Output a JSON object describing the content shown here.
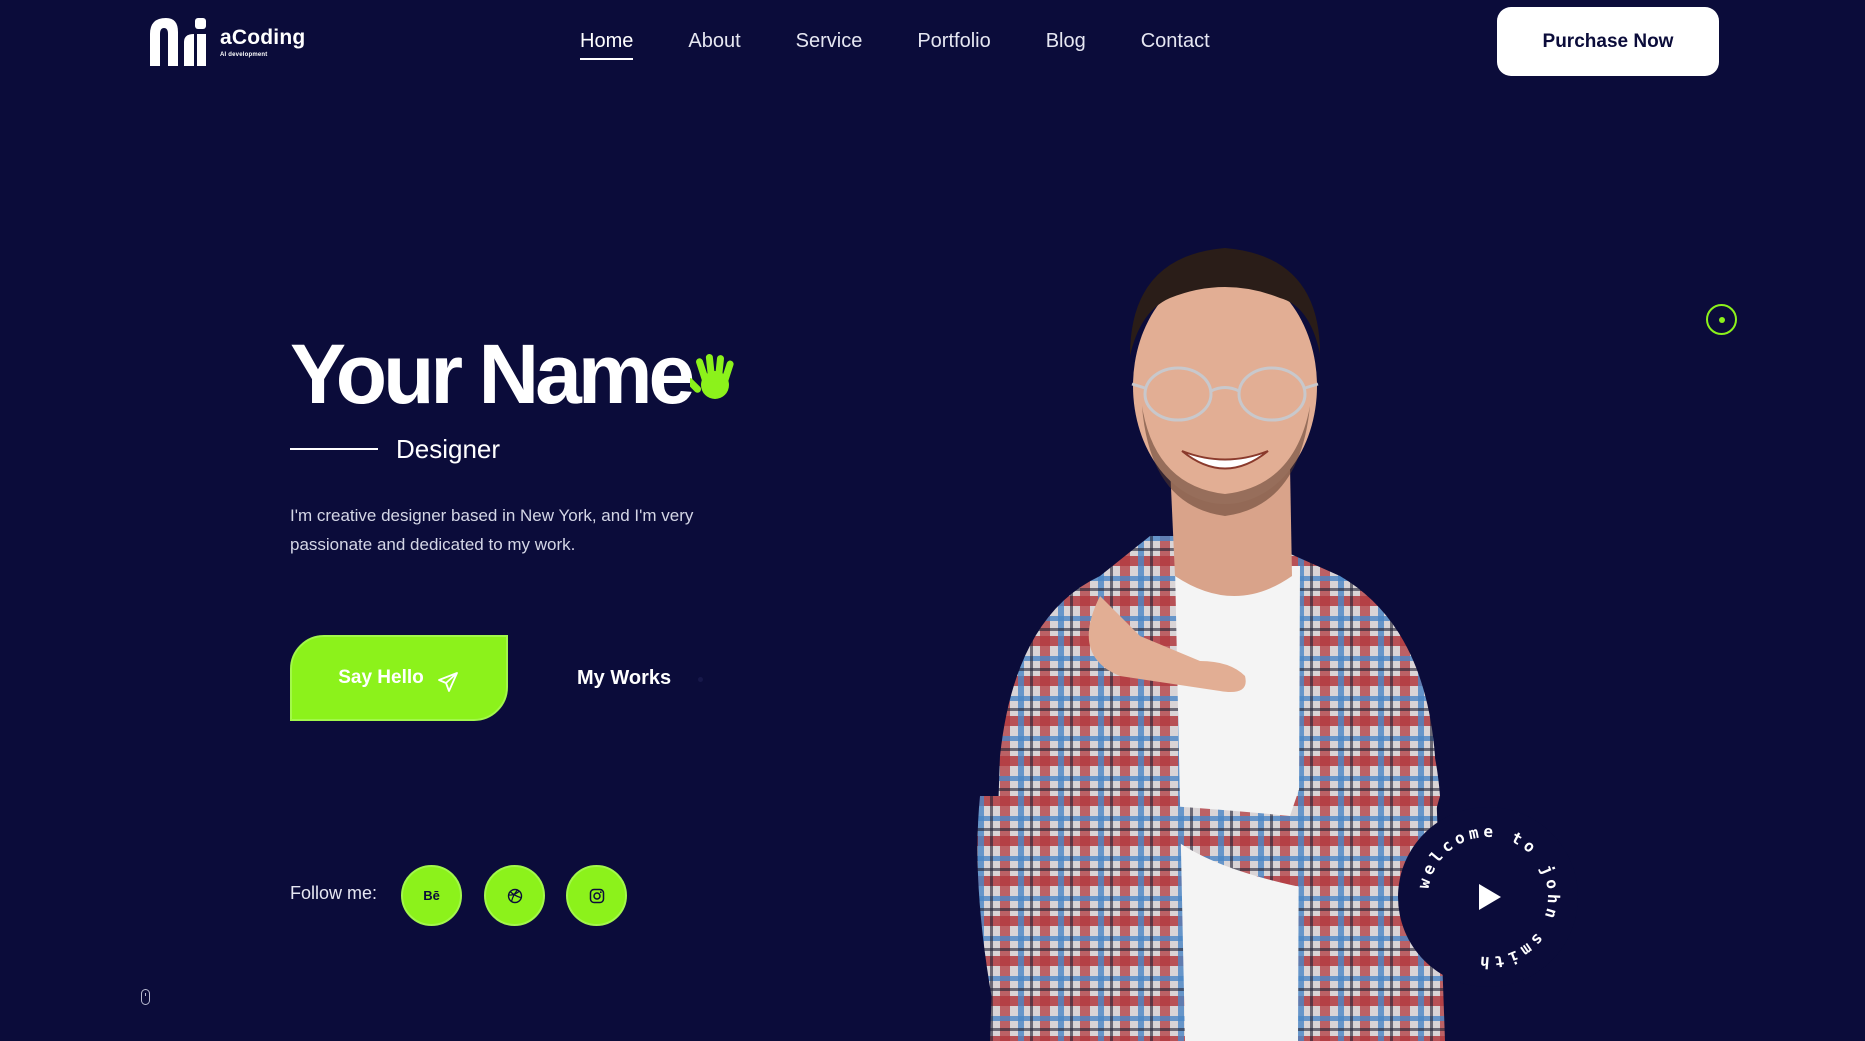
{
  "brand": {
    "name": "aCoding",
    "tagline": "AI development"
  },
  "nav": {
    "items": [
      {
        "label": "Home",
        "active": true
      },
      {
        "label": "About",
        "active": false
      },
      {
        "label": "Service",
        "active": false
      },
      {
        "label": "Portfolio",
        "active": false
      },
      {
        "label": "Blog",
        "active": false
      },
      {
        "label": "Contact",
        "active": false
      }
    ]
  },
  "header": {
    "purchase_label": "Purchase Now"
  },
  "hero": {
    "name": "Your Name",
    "role": "Designer",
    "description": "I'm creative designer based in New York, and I'm very passionate and dedicated to my work.",
    "say_hello_label": "Say Hello",
    "my_works_label": "My Works",
    "follow_label": "Follow me:"
  },
  "social": [
    {
      "label": "Bē",
      "icon": "behance-icon"
    },
    {
      "label": "",
      "icon": "dribbble-icon"
    },
    {
      "label": "",
      "icon": "instagram-icon"
    }
  ],
  "badge": {
    "text": "welcome to john smith",
    "icon": "play-icon"
  },
  "colors": {
    "background": "#0b0c3a",
    "accent": "#8cf21b",
    "text": "#ffffff"
  }
}
